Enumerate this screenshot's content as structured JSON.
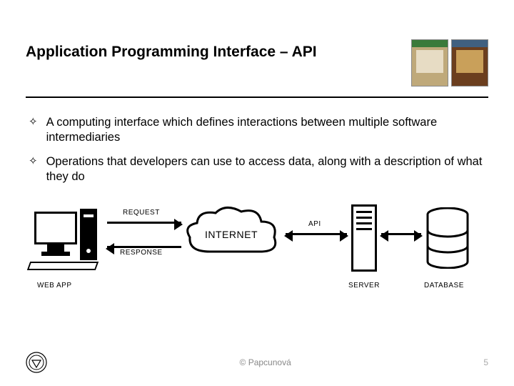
{
  "header": {
    "title": "Application Programming Interface – API"
  },
  "bullets": [
    "A computing interface which defines interactions between multiple software intermediaries",
    "Operations that developers can use to access data, along with a description of what they do"
  ],
  "diagram": {
    "webapp_label": "WEB APP",
    "request_label": "REQUEST",
    "response_label": "RESPONSE",
    "internet_label": "INTERNET",
    "api_label": "API",
    "server_label": "SERVER",
    "database_label": "DATABASE"
  },
  "footer": {
    "copyright": "© Papcunová",
    "page": "5"
  }
}
